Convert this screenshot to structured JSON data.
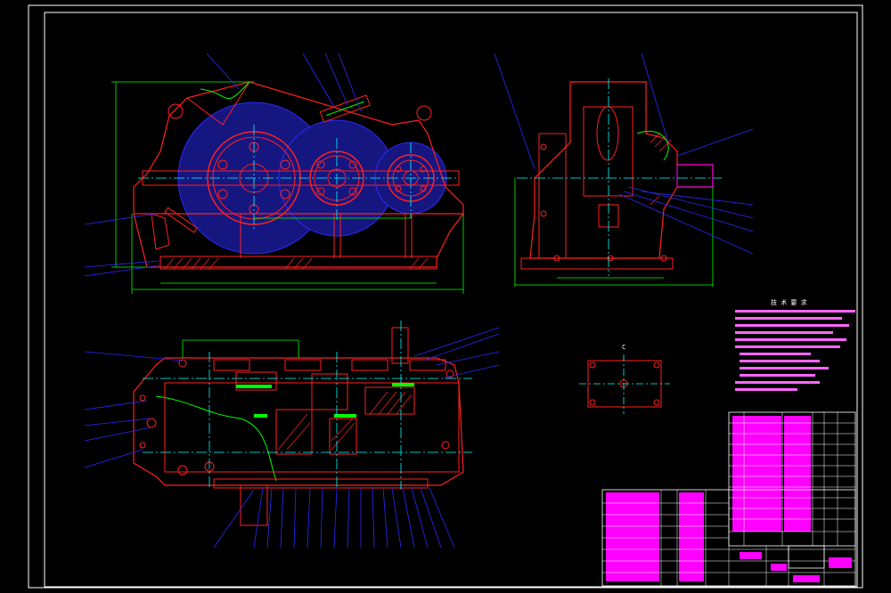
{
  "drawing": {
    "type": "CAD assembly drawing",
    "background": "#000000",
    "colors": {
      "frame": "#ffffff",
      "outline": "#ff2020",
      "dimension": "#00ff00",
      "leader": "#2a2aff",
      "centerline": "#00ffff",
      "hatch": "#ff2020",
      "titleblock_fill": "#ff00ff",
      "gear_fill": "#1a1a8a"
    }
  },
  "views": {
    "front_view_label": "",
    "side_view_label": "",
    "top_view_label": "",
    "detail_label": "C"
  },
  "notes": {
    "heading": "技 术 要 求"
  }
}
